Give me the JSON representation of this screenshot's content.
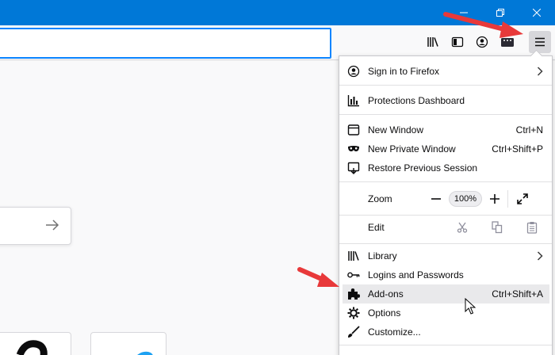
{
  "colors": {
    "titlebar": "#0078d7",
    "annotation_arrow": "#e8393a",
    "hover": "#e9e9eb"
  },
  "window_controls": {
    "minimize_icon": "minimize-icon",
    "restore_icon": "restore-icon",
    "close_icon": "close-icon"
  },
  "toolbar": {
    "icons": [
      "library-icon",
      "sidebar-icon",
      "account-icon",
      "extension-icon",
      "hamburger-menu-icon"
    ]
  },
  "menu": {
    "sign_in": {
      "label": "Sign in to Firefox",
      "icon": "account-icon"
    },
    "protections": {
      "label": "Protections Dashboard",
      "icon": "chart-icon"
    },
    "new_window": {
      "label": "New Window",
      "shortcut": "Ctrl+N",
      "icon": "window-icon"
    },
    "private_window": {
      "label": "New Private Window",
      "shortcut": "Ctrl+Shift+P",
      "icon": "mask-icon"
    },
    "restore_session": {
      "label": "Restore Previous Session",
      "icon": "restore-session-icon"
    },
    "zoom": {
      "label": "Zoom",
      "minus": "−",
      "value": "100%",
      "plus": "+",
      "fullscreen_icon": "fullscreen-icon"
    },
    "edit": {
      "label": "Edit",
      "cut_icon": "scissors-icon",
      "copy_icon": "copy-icon",
      "paste_icon": "paste-icon"
    },
    "library": {
      "label": "Library",
      "icon": "library-icon"
    },
    "logins": {
      "label": "Logins and Passwords",
      "icon": "key-icon"
    },
    "addons": {
      "label": "Add-ons",
      "shortcut": "Ctrl+Shift+A",
      "icon": "puzzle-icon"
    },
    "options": {
      "label": "Options",
      "icon": "gear-icon"
    },
    "customize": {
      "label": "Customize...",
      "icon": "brush-icon"
    }
  }
}
